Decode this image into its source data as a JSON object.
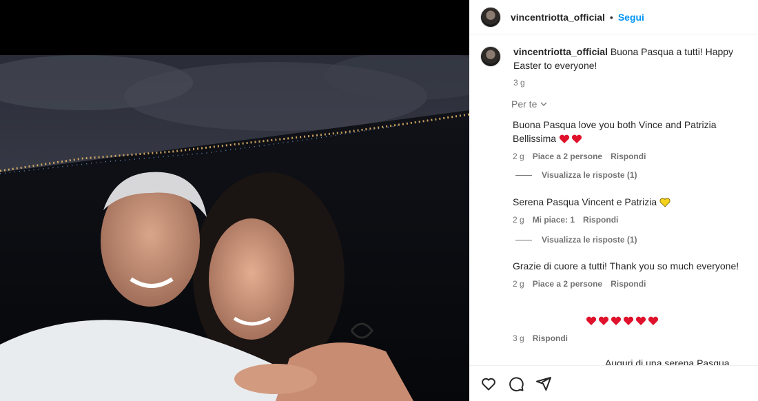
{
  "post": {
    "username": "vincentriotta_official",
    "follow_label": "Segui",
    "separator": "•"
  },
  "caption": {
    "username": "vincentriotta_official",
    "text": "Buona Pasqua a tutti! Happy Easter to everyone!",
    "time": "3 g"
  },
  "sort_label": "Per te",
  "comments": [
    {
      "text": "Buona Pasqua love you both Vince and Patrizia Bellissima",
      "time": "2 g",
      "likes": "Piace a 2 persone",
      "reply": "Rispondi",
      "emoji": "red-heart x2",
      "view_replies": "Visualizza le risposte (1)"
    },
    {
      "text": "Serena Pasqua Vincent e Patrizia",
      "time": "2 g",
      "likes": "Mi piace: 1",
      "reply": "Rispondi",
      "emoji": "yellow-heart",
      "view_replies": "Visualizza le risposte (1)"
    },
    {
      "text": "Grazie di cuore a tutti! Thank you so much everyone!",
      "time": "2 g",
      "likes": "Piace a 2 persone",
      "reply": "Rispondi"
    },
    {
      "text": "",
      "emoji": "red-heart x6",
      "time": "3 g",
      "reply": "Rispondi"
    },
    {
      "text": "Auguri di una serena Pasqua grande"
    }
  ],
  "icons": {
    "like": "heart-icon",
    "comment": "comment-icon",
    "share": "share-icon"
  },
  "colors": {
    "accent": "#0095f6",
    "secondary_text": "#737373",
    "heart_red": "#e0112b",
    "heart_yellow": "#f5d21b"
  }
}
